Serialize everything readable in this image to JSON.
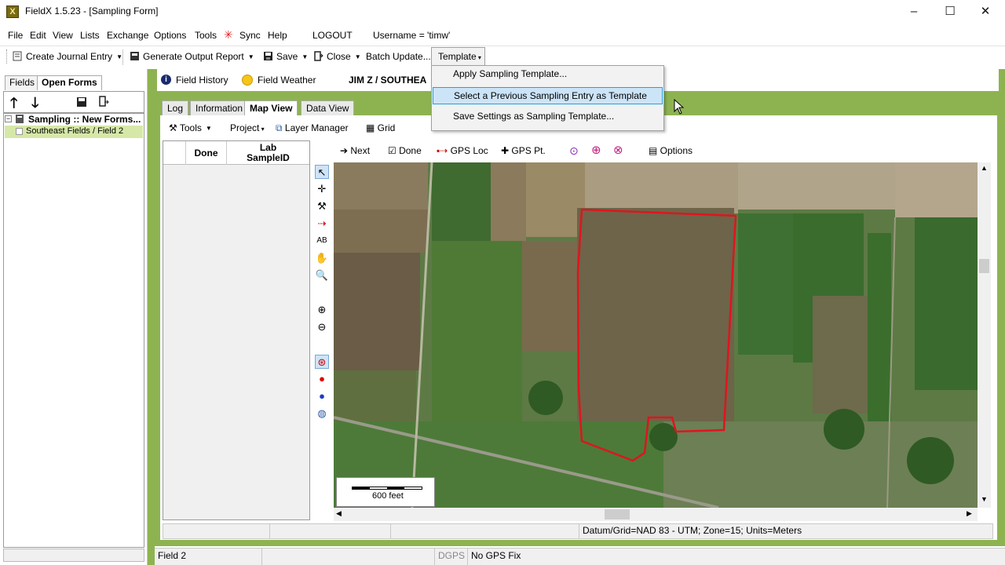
{
  "window": {
    "title": "FieldX 1.5.23 - [Sampling Form]",
    "app_icon_glyph": "X",
    "minimize_glyph": "–",
    "maximize_glyph": "☐",
    "close_glyph": "✕"
  },
  "menu": {
    "file": "File",
    "edit": "Edit",
    "view": "View",
    "lists": "Lists",
    "exchange": "Exchange",
    "options": "Options",
    "tools": "Tools",
    "sync": "Sync",
    "help": "Help",
    "logout": "LOGOUT",
    "username": "Username = 'timw'"
  },
  "toolbar": {
    "create_journal": "Create Journal Entry",
    "generate_report": "Generate Output Report",
    "save": "Save",
    "close": "Close",
    "batch_update": "Batch Update...",
    "template": "Template"
  },
  "template_menu": {
    "items": [
      "Apply Sampling Template...",
      "Select a Previous Sampling Entry as Template",
      "Save Settings as Sampling Template..."
    ],
    "highlighted_index": 1
  },
  "left_panel": {
    "tabs": [
      "Fields",
      "Open Forms"
    ],
    "active_tab": "Open Forms",
    "tree": {
      "root": "Sampling :: New Forms...",
      "child": "Southeast Fields / Field 2"
    }
  },
  "header": {
    "field_history": "Field History",
    "field_weather": "Field Weather",
    "client_name": "JIM Z / SOUTHEA"
  },
  "view_tabs": [
    "Log",
    "Information",
    "Map View",
    "Data View"
  ],
  "active_view_tab": "Map View",
  "sub_toolbar": {
    "tools": "Tools",
    "project": "Project",
    "layer_manager": "Layer Manager",
    "grid": "Grid"
  },
  "grid": {
    "columns": [
      "Done",
      "Lab\nSampleID"
    ]
  },
  "map_toolbar": {
    "next": "Next",
    "done": "Done",
    "gps_loc": "GPS Loc",
    "gps_pt": "GPS Pt.",
    "options": "Options"
  },
  "map": {
    "scale_label": "600 feet",
    "boundary_color": "#e0141e"
  },
  "map_status": {
    "datum": "Datum/Grid=NAD 83 - UTM; Zone=15; Units=Meters"
  },
  "status_bar": {
    "field": "Field 2",
    "dgps": "DGPS",
    "gps_fix": "No GPS Fix"
  },
  "colors": {
    "accent_green": "#8db351",
    "highlight_blue": "#cce4f7"
  }
}
